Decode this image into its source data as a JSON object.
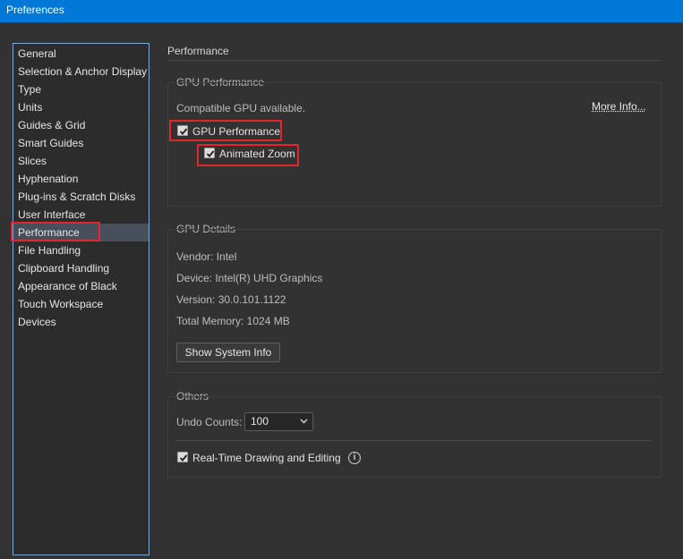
{
  "window": {
    "title": "Preferences"
  },
  "sidebar": {
    "items": [
      {
        "label": "General"
      },
      {
        "label": "Selection & Anchor Display"
      },
      {
        "label": "Type"
      },
      {
        "label": "Units"
      },
      {
        "label": "Guides & Grid"
      },
      {
        "label": "Smart Guides"
      },
      {
        "label": "Slices"
      },
      {
        "label": "Hyphenation"
      },
      {
        "label": "Plug-ins & Scratch Disks"
      },
      {
        "label": "User Interface"
      },
      {
        "label": "Performance",
        "selected": true
      },
      {
        "label": "File Handling"
      },
      {
        "label": "Clipboard Handling"
      },
      {
        "label": "Appearance of Black"
      },
      {
        "label": "Touch Workspace"
      },
      {
        "label": "Devices"
      }
    ]
  },
  "main": {
    "title": "Performance",
    "gpu_performance": {
      "group_label": "GPU Performance",
      "status": "Compatible GPU available.",
      "more_info_link": "More Info...",
      "gpu_checkbox_label": "GPU Performance",
      "gpu_checked": true,
      "animated_zoom_label": "Animated Zoom",
      "animated_zoom_checked": true
    },
    "gpu_details": {
      "group_label": "GPU Details",
      "vendor": "Vendor: Intel",
      "device": "Device: Intel(R) UHD Graphics",
      "version": "Version: 30.0.101.1122",
      "memory": "Total Memory: 1024 MB",
      "show_system_info_button": "Show System Info"
    },
    "others": {
      "group_label": "Others",
      "undo_label": "Undo Counts:",
      "undo_value": "100",
      "realtime_label": "Real-Time Drawing and Editing",
      "realtime_checked": true,
      "info_glyph": "i"
    }
  },
  "colors": {
    "accent": "#0078d7",
    "highlight_box": "#e2262b",
    "background": "#323232"
  }
}
